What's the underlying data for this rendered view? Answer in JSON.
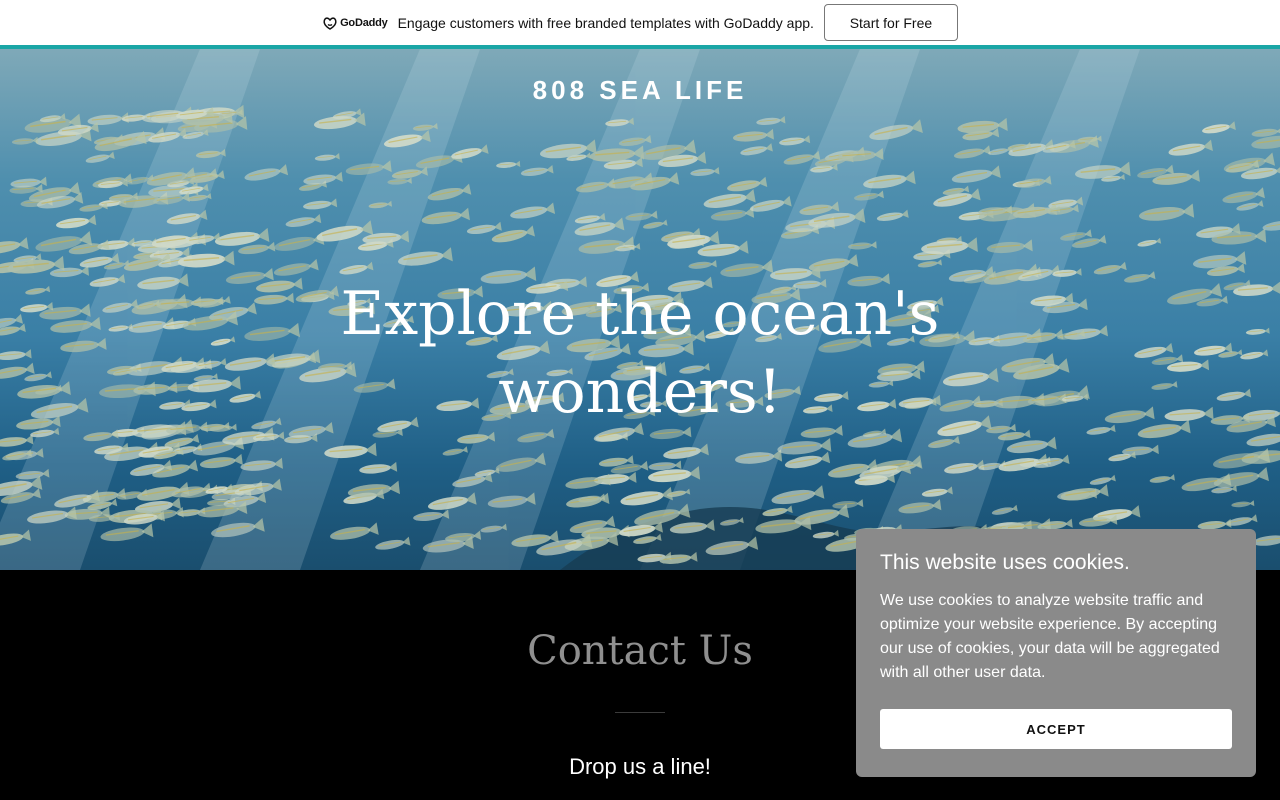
{
  "promo": {
    "logo_text": "GoDaddy",
    "text": "Engage customers with free branded templates with GoDaddy app.",
    "cta_label": "Start for Free",
    "accent_color": "#1aa6a6"
  },
  "hero": {
    "site_title": "808 SEA LIFE",
    "headline_line1": "Explore the ocean's",
    "headline_line2": "wonders!"
  },
  "contact": {
    "title": "Contact Us",
    "subtitle": "Drop us a line!"
  },
  "cookie_banner": {
    "title": "This website uses cookies.",
    "body": "We use cookies to analyze website traffic and optimize your website experience. By accepting our use of cookies, your data will be aggregated with all other user data.",
    "accept_label": "ACCEPT"
  }
}
